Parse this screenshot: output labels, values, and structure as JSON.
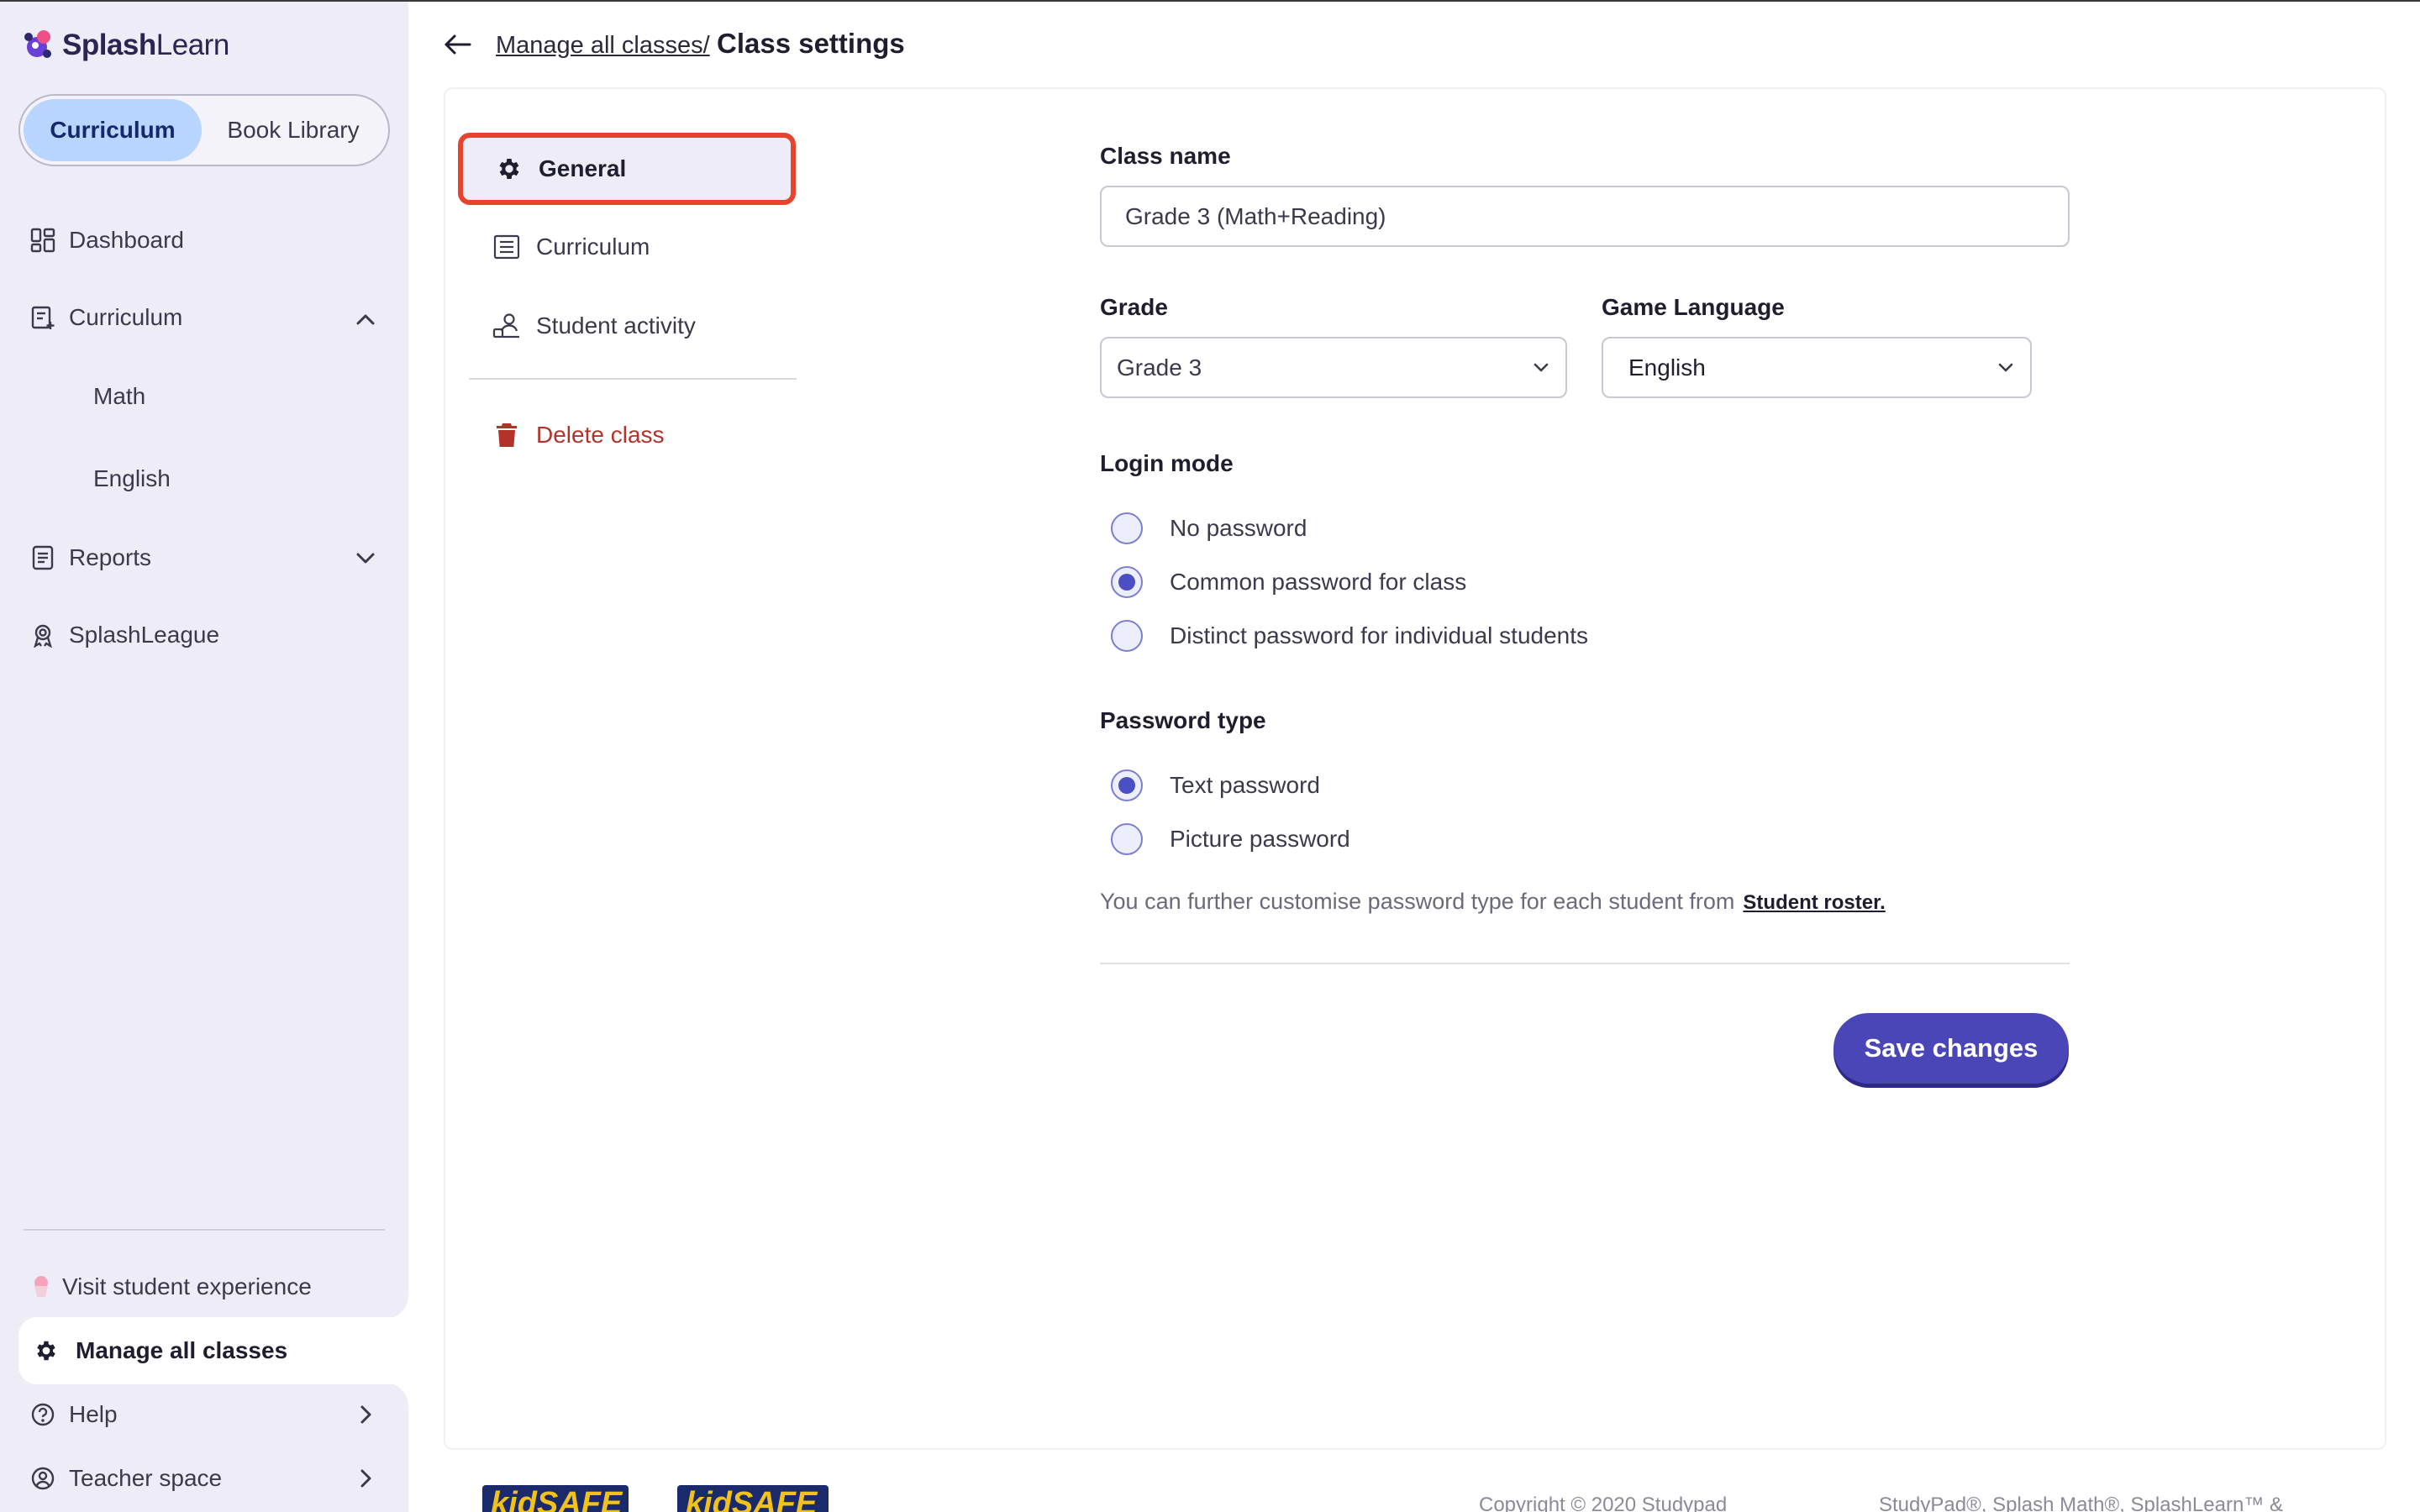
{
  "brand": {
    "name_bold": "Splash",
    "name_rest": "Learn"
  },
  "sidebar": {
    "toggle": {
      "active": "Curriculum",
      "inactive": "Book Library"
    },
    "items": [
      {
        "label": "Dashboard",
        "icon": "dashboard-icon"
      },
      {
        "label": "Curriculum",
        "icon": "curriculum-icon"
      },
      {
        "label": "Math"
      },
      {
        "label": "English"
      },
      {
        "label": "Reports",
        "icon": "reports-icon"
      },
      {
        "label": "SplashLeague",
        "icon": "league-icon"
      }
    ],
    "visit": "Visit student experience",
    "manage": "Manage all classes",
    "help": "Help",
    "teacher": "Teacher space"
  },
  "breadcrumb": {
    "link": "Manage all classes/",
    "title": "Class settings"
  },
  "tabs": {
    "general": "General",
    "curriculum": "Curriculum",
    "student_activity": "Student activity",
    "delete": "Delete class"
  },
  "form": {
    "class_name_label": "Class name",
    "class_name_value": "Grade 3 (Math+Reading)",
    "grade_label": "Grade",
    "grade_value": "Grade 3",
    "language_label": "Game Language",
    "language_value": "English",
    "login_mode_label": "Login mode",
    "login_modes": [
      "No password",
      "Common password for class",
      "Distinct password for individual students"
    ],
    "login_selected": "Common password for class",
    "password_type_label": "Password type",
    "password_types": [
      "Text password",
      "Picture password"
    ],
    "password_selected": "Text password",
    "hint_text": "You can further customise password type for each student from",
    "hint_link": "Student roster.",
    "save": "Save changes"
  },
  "footer": {
    "badge1": "kidSAFE",
    "badge2": "kidSAFE",
    "copyright": "Copyright © 2020 Studypad",
    "trademark": "StudyPad®, Splash Math®, SplashLearn™ &"
  },
  "colors": {
    "accent": "#4a46b8",
    "highlight": "#e8432c",
    "sidebar_bg": "#eeedf7",
    "delete": "#b3332a"
  }
}
